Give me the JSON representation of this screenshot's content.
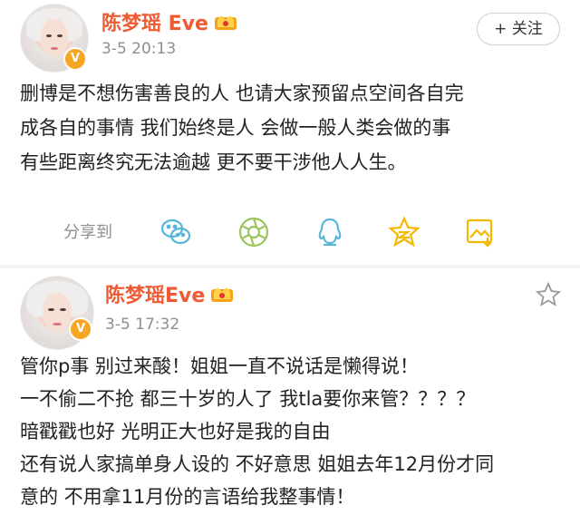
{
  "post1": {
    "username": "陈梦瑶 Eve",
    "timestamp": "3-5 20:13",
    "follow_label": "+ 关注",
    "lines": [
      "删博是不想伤害善良的人 也请大家预留点空间各自完",
      "成各自的事情 我们始终是人 会做一般人类会做的事",
      "有些距离终究无法逾越 更不要干涉他人人生。"
    ],
    "share_label": "分享到",
    "share_icons": [
      "wechat-icon",
      "moments-icon",
      "qq-icon",
      "qzone-icon",
      "save-image-icon"
    ]
  },
  "post2": {
    "username": "陈梦瑶Eve",
    "timestamp": "3-5 17:32",
    "lines": [
      "管你p事 别过来酸！姐姐一直不说话是懒得说！",
      "一不偷二不抢 都三十岁的人了 我tla要你来管？？？？",
      "暗戳戳也好 光明正大也好是我的自由",
      "还有说人家搞单身人设的 不好意思 姐姐去年12月份才同",
      "意的 不用拿11月份的言语给我整事情！"
    ]
  },
  "colors": {
    "username": "#f05a32",
    "share_icon": "#58b6d8",
    "moments_icon": "#9cc65c",
    "qzone_icon": "#f5b800",
    "verified_badge": "#f5a623"
  }
}
